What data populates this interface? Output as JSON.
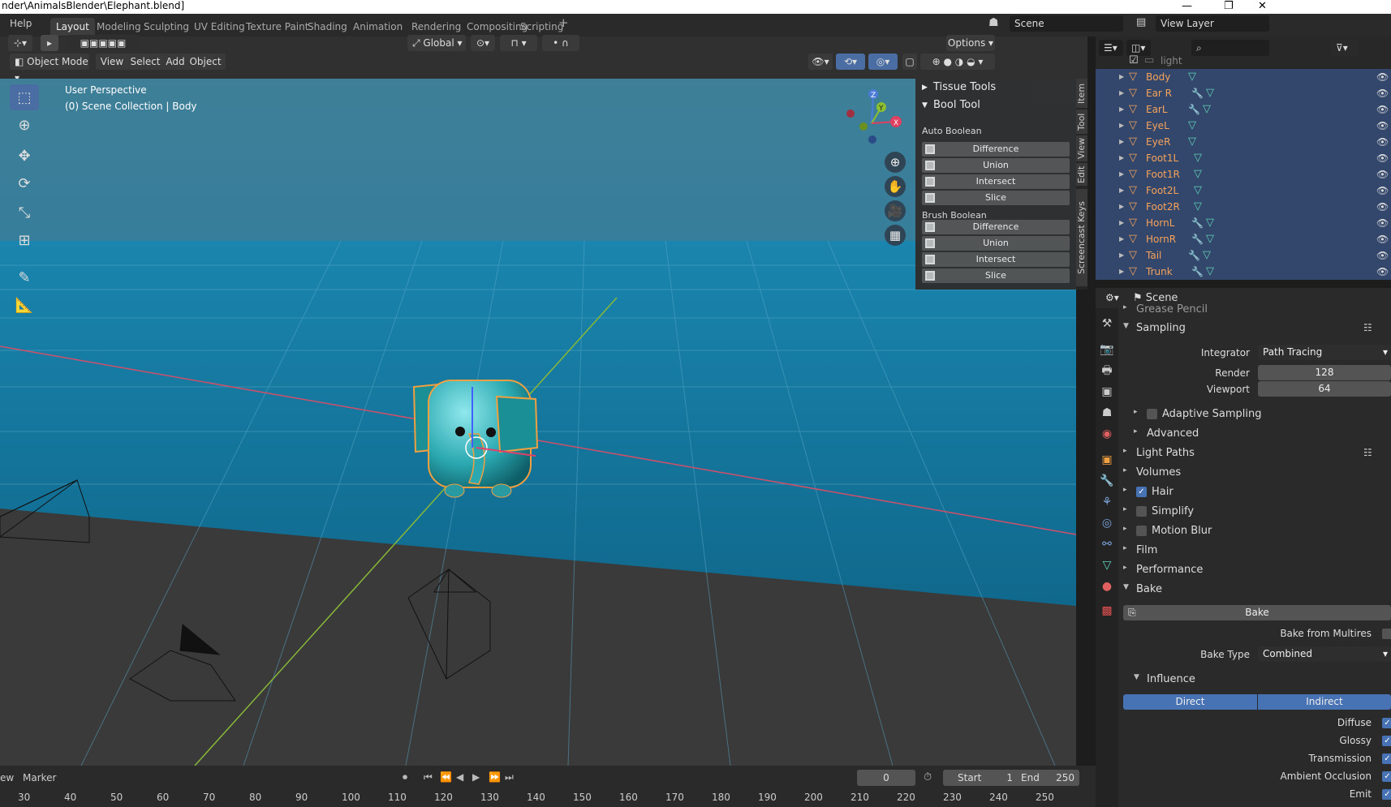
{
  "window": {
    "title": "nder\\AnimalsBlender\\Elephant.blend]",
    "min": "—",
    "restore": "❐",
    "close": "✕"
  },
  "menu": {
    "help": "Help"
  },
  "workspaces": [
    "Layout",
    "Modeling",
    "Sculpting",
    "UV Editing",
    "Texture Paint",
    "Shading",
    "Animation",
    "Rendering",
    "Compositing",
    "Scripting"
  ],
  "active_workspace": "Layout",
  "add_workspace": "+",
  "scene_selector": {
    "value": "Scene"
  },
  "view_layer_selector": {
    "value": "View Layer"
  },
  "viewport_header": {
    "transform_orientation": "Global",
    "options": "Options",
    "mode": "Object Mode",
    "menus": [
      "View",
      "Select",
      "Add",
      "Object"
    ]
  },
  "viewport_overlay": {
    "perspective": "User Perspective",
    "collection": "(0) Scene Collection | Body"
  },
  "gizmo": {
    "z": "Z",
    "y": "Y",
    "x": "X"
  },
  "npanel": {
    "tissue_tools": "Tissue Tools",
    "bool_tool": "Bool Tool",
    "auto_boolean": "Auto Boolean",
    "auto_buttons": [
      "Difference",
      "Union",
      "Intersect",
      "Slice"
    ],
    "brush_boolean": "Brush Boolean",
    "brush_buttons": [
      "Difference",
      "Union",
      "Intersect",
      "Slice"
    ],
    "tabs": [
      "Item",
      "Tool",
      "View",
      "Edit",
      "Screencast Keys"
    ]
  },
  "outliner": {
    "partial_row": "light",
    "items": [
      {
        "name": "Body",
        "mod": false
      },
      {
        "name": "Ear R",
        "mod": true
      },
      {
        "name": "EarL",
        "mod": true
      },
      {
        "name": "EyeL",
        "mod": false
      },
      {
        "name": "EyeR",
        "mod": false
      },
      {
        "name": "Foot1L",
        "mod": false
      },
      {
        "name": "Foot1R",
        "mod": false
      },
      {
        "name": "Foot2L",
        "mod": false
      },
      {
        "name": "Foot2R",
        "mod": false
      },
      {
        "name": "HornL",
        "mod": true
      },
      {
        "name": "HornR",
        "mod": true
      },
      {
        "name": "Tail",
        "mod": true
      },
      {
        "name": "Trunk",
        "mod": true
      }
    ]
  },
  "properties": {
    "context": "Scene",
    "partial_top": "Grease Pencil",
    "sampling": "Sampling",
    "integrator_label": "Integrator",
    "integrator_value": "Path Tracing",
    "render_label": "Render",
    "render_value": "128",
    "viewport_label": "Viewport",
    "viewport_value": "64",
    "adaptive_sampling": "Adaptive Sampling",
    "advanced": "Advanced",
    "light_paths": "Light Paths",
    "volumes": "Volumes",
    "hair": "Hair",
    "simplify": "Simplify",
    "motion_blur": "Motion Blur",
    "film": "Film",
    "performance": "Performance",
    "bake": "Bake",
    "bake_button": "Bake",
    "bake_from_multires": "Bake from Multires",
    "bake_type_label": "Bake Type",
    "bake_type_value": "Combined",
    "influence": "Influence",
    "direct": "Direct",
    "indirect": "Indirect",
    "influence_items": [
      "Diffuse",
      "Glossy",
      "Transmission",
      "Ambient Occlusion",
      "Emit"
    ]
  },
  "timeline": {
    "view": "ew",
    "marker": "Marker",
    "current_frame": "0",
    "start_label": "Start",
    "start_value": "1",
    "end_label": "End",
    "end_value": "250",
    "ruler": [
      "30",
      "40",
      "50",
      "60",
      "70",
      "80",
      "90",
      "100",
      "110",
      "120",
      "130",
      "140",
      "150",
      "160",
      "170",
      "180",
      "190",
      "200",
      "210",
      "220",
      "230",
      "240",
      "250"
    ]
  }
}
